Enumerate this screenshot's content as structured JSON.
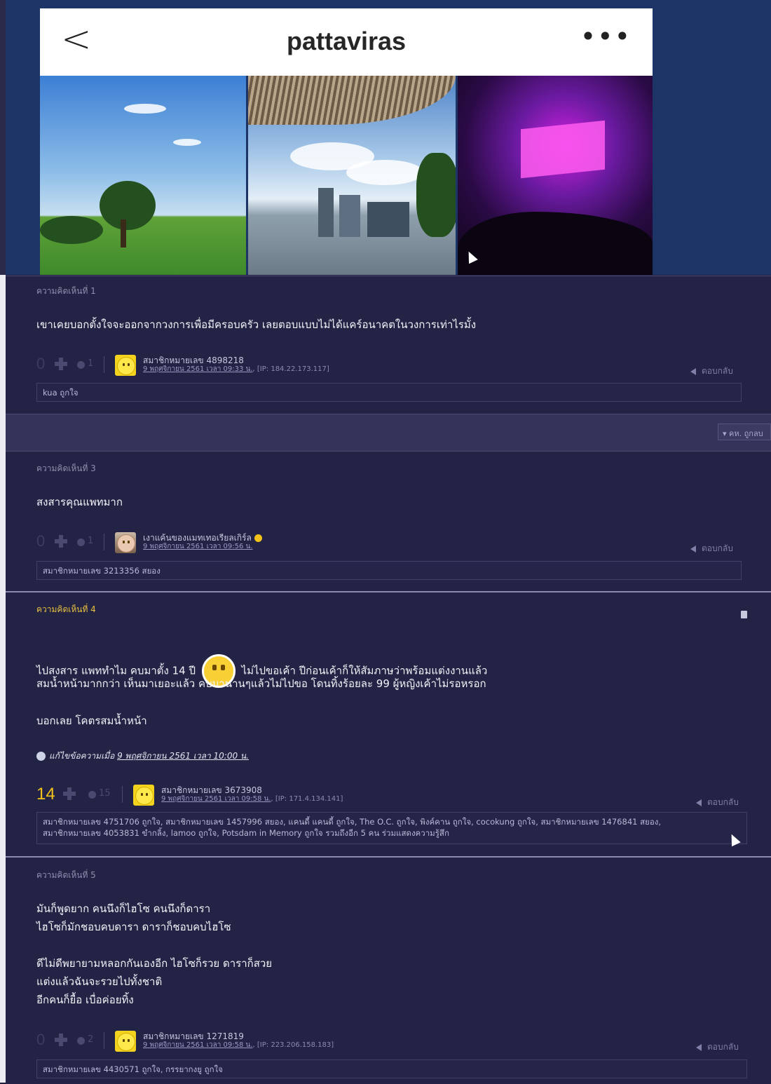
{
  "instagram": {
    "back_glyph": "<",
    "username": "pattaviras",
    "more_glyph": "•••"
  },
  "colors": {
    "page_bg": "#1f1f3c",
    "comment_bg": "#232345",
    "highlight": "#f3c21b"
  },
  "comments": [
    {
      "label": "ความคิดเห็นที่ 1",
      "body": "เขาเคยบอกตั้งใจจะออกจากวงการเพื่อมีครอบครัว  เลยตอบแบบไม่ได้แคร์อนาคตในวงการเท่าไรมั้ง",
      "votes": "0",
      "emotions": "1",
      "member": "สมาชิกหมายเลข 4898218",
      "date": "9 พฤศจิกายน 2561 เวลา 09:33 น.",
      "ip": "[IP: 184.22.173.117]",
      "reply": "ตอบกลับ",
      "reactions": "kua ถูกใจ"
    },
    {
      "label": "ความคิดเห็นที่ 3",
      "body": "สงสารคุณแพทมาก",
      "votes": "0",
      "emotions": "1",
      "member": "เงาแค้นของแมทเทอเรียลเกิร์ล",
      "date": "9 พฤศจิกายน 2561 เวลา 09:56 น.",
      "ip": "",
      "reply": "ตอบกลับ",
      "reactions": "สมาชิกหมายเลข 3213356 สยอง"
    },
    {
      "label": "ความคิดเห็นที่ 4",
      "body_line1a": "ไปสงสาร แพททำไม คบมาตั้ง 14 ปี",
      "body_line1b": "ไม่ไปขอเค้า ปีก่อนเค้าก็ให้สัมภาษว่าพร้อมแต่งงานแล้ว",
      "body_line2": "สมน้ำหน้ามากกว่า เห็นมาเยอะแล้ว คบมานานๆแล้วไม่ไปขอ โดนทิ้งร้อยละ 99 ผู้หญิงเค้าไม่รอหรอก",
      "body_line3": "บอกเลย โคตรสมน้ำหน้า",
      "edit_prefix": "แก้ไขข้อความเมื่อ",
      "edit_date": "9 พฤศจิกายน 2561 เวลา 10:00 น.",
      "votes": "14",
      "emotions": "15",
      "member": "สมาชิกหมายเลข 3673908",
      "date": "9 พฤศจิกายน 2561 เวลา 09:58 น.",
      "ip": "[IP: 171.4.134.141]",
      "reply": "ตอบกลับ",
      "reactions_line1": "สมาชิกหมายเลข 4751706 ถูกใจ, สมาชิกหมายเลข 1457996 สยอง, แคนดี้ แคนดี้ ถูกใจ, The O.C. ถูกใจ, พิงค์คาน ถูกใจ, cocokung ถูกใจ, สมาชิกหมายเลข 1476841 สยอง,",
      "reactions_line2": "สมาชิกหมายเลข 4053831 ขำกลิ้ง, lamoo ถูกใจ, Potsdam in Memory ถูกใจ รวมถึงอีก 5 คน ร่วมแสดงความรู้สึก"
    },
    {
      "label": "ความคิดเห็นที่ 5",
      "body_lines": [
        "มันก็พูดยาก คนนึงก็ไฮโซ คนนึงก็ดารา",
        "ไฮโซก็มักชอบคบดารา  ดาราก็ชอบคบไฮโซ",
        "",
        "ดีไม่ดีพยายามหลอกกันเองอีก ไฮโซก็รวย ดาราก็สวย",
        "แต่งแล้วฉันจะรวยไปทั้งชาติ",
        "อีกคนก็ยื้อ เบื่อค่อยทิ้ง"
      ],
      "votes": "0",
      "emotions": "2",
      "member": "สมาชิกหมายเลข 1271819",
      "date": "9 พฤศจิกายน 2561 เวลา 09:58 น.",
      "ip": "[IP: 223.206.158.183]",
      "reply": "ตอบกลับ",
      "reactions": "สมาชิกหมายเลข 4430571 ถูกใจ, กรรยากงยู ถูกใจ"
    }
  ],
  "sort_button": "▾ คห. ถูกลบ"
}
